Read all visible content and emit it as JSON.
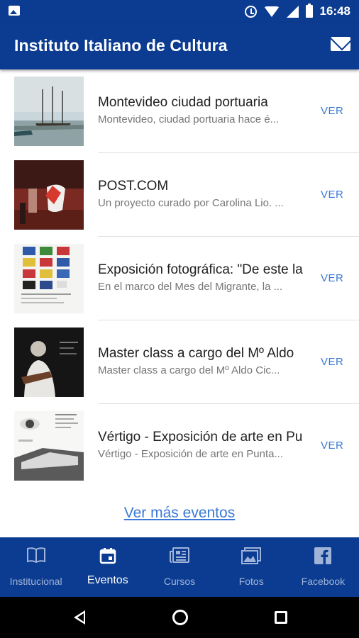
{
  "status_bar": {
    "time": "16:48"
  },
  "app_bar": {
    "title": "Instituto Italiano de Cultura"
  },
  "events": [
    {
      "title": "Montevideo ciudad portuaria",
      "subtitle": "Montevideo, ciudad portuaria hace é...",
      "action": "VER"
    },
    {
      "title": "POST.COM",
      "subtitle": "Un proyecto curado por Carolina Lio. ...",
      "action": "VER"
    },
    {
      "title": "Exposición fotográfica: \"De este la",
      "subtitle": "En el marco del Mes del Migrante, la ...",
      "action": "VER"
    },
    {
      "title": "Master class a cargo del Mº Aldo",
      "subtitle": "Master class a cargo del Mº Aldo Cic...",
      "action": "VER"
    },
    {
      "title": "Vértigo - Exposición de arte en Pu",
      "subtitle": "Vértigo - Exposición de arte en Punta...",
      "action": "VER"
    }
  ],
  "more_link": "Ver más eventos",
  "bottom_nav": [
    {
      "label": "Institucional",
      "icon": "book-icon"
    },
    {
      "label": "Eventos",
      "icon": "calendar-icon",
      "active": true
    },
    {
      "label": "Cursos",
      "icon": "newspaper-icon"
    },
    {
      "label": "Fotos",
      "icon": "photos-icon"
    },
    {
      "label": "Facebook",
      "icon": "facebook-icon"
    }
  ],
  "colors": {
    "primary": "#0c3c91",
    "link": "#3b79d6",
    "inactive_nav": "#9fb4d8"
  }
}
